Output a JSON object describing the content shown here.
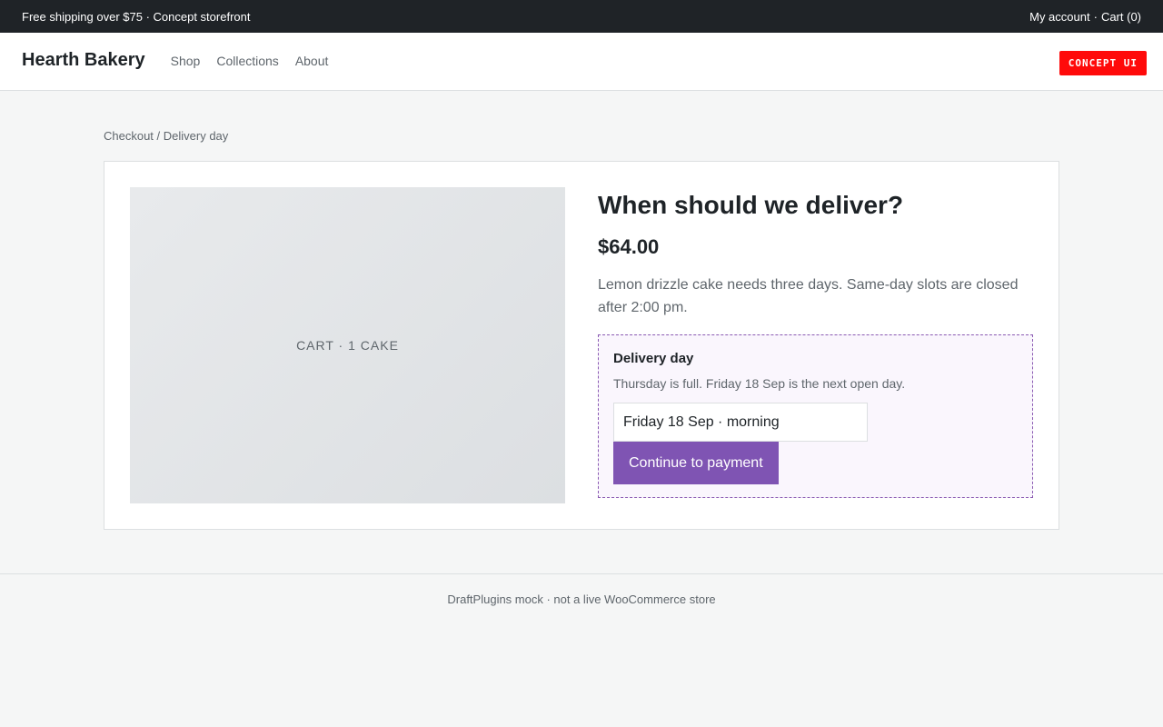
{
  "topbar": {
    "promo": "Free shipping over $75 · Concept storefront",
    "my_account": "My account",
    "separator": "·",
    "cart": "Cart (0)"
  },
  "header": {
    "logo": "Hearth Bakery",
    "nav": [
      "Shop",
      "Collections",
      "About"
    ],
    "badge": "CONCEPT UI"
  },
  "breadcrumb": "Checkout / Delivery day",
  "product": {
    "image_label": "CART · 1 CAKE",
    "title": "When should we deliver?",
    "price": "$64.00",
    "description": "Lemon drizzle cake needs three days. Same-day slots are closed after 2:00 pm."
  },
  "delivery": {
    "label": "Delivery day",
    "note": "Thursday is full. Friday 18 Sep is the next open day.",
    "slot_value": "Friday 18 Sep · morning",
    "continue_label": "Continue to payment"
  },
  "footer": "DraftPlugins mock · not a live WooCommerce store",
  "colors": {
    "accent": "#7f54b3",
    "topbar": "#1f2327",
    "badge": "#ff0a0a"
  }
}
